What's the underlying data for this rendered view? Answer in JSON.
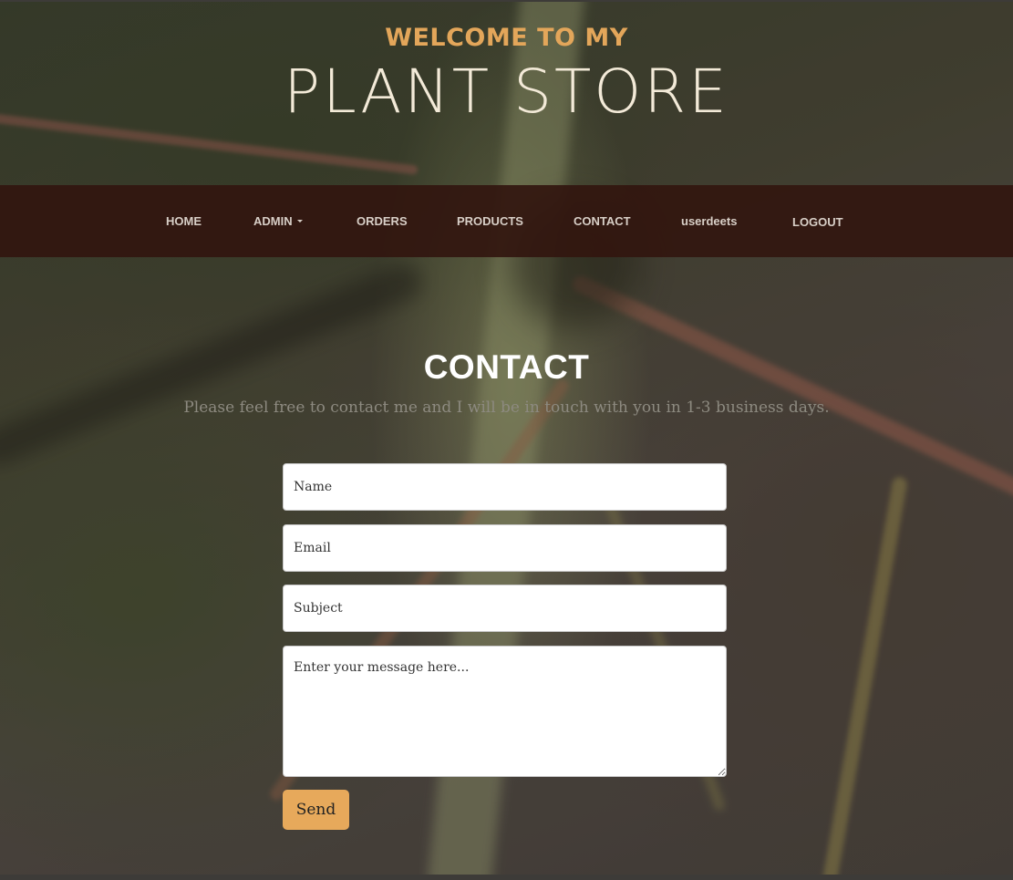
{
  "header": {
    "welcome": "WELCOME TO MY",
    "store_name": "PLANT STORE"
  },
  "nav": {
    "items": [
      {
        "label": "HOME"
      },
      {
        "label": "ADMIN"
      },
      {
        "label": "ORDERS"
      },
      {
        "label": "PRODUCTS"
      },
      {
        "label": "CONTACT"
      },
      {
        "label": "userdeets"
      },
      {
        "label": "LOGOUT"
      }
    ]
  },
  "contact": {
    "title": "CONTACT",
    "subtitle": "Please feel free to contact me and I will be in touch with you in 1-3 business days.",
    "name_placeholder": "Name",
    "email_placeholder": "Email",
    "subject_placeholder": "Subject",
    "message_placeholder": "Enter your message here...",
    "send_label": "Send"
  },
  "colors": {
    "accent": "#e7a95b",
    "nav_bg": "#32160f",
    "title_text": "#f3ead8"
  },
  "icons": {
    "dropdown": "caret-down-icon",
    "resize": "textarea-resize-icon"
  }
}
